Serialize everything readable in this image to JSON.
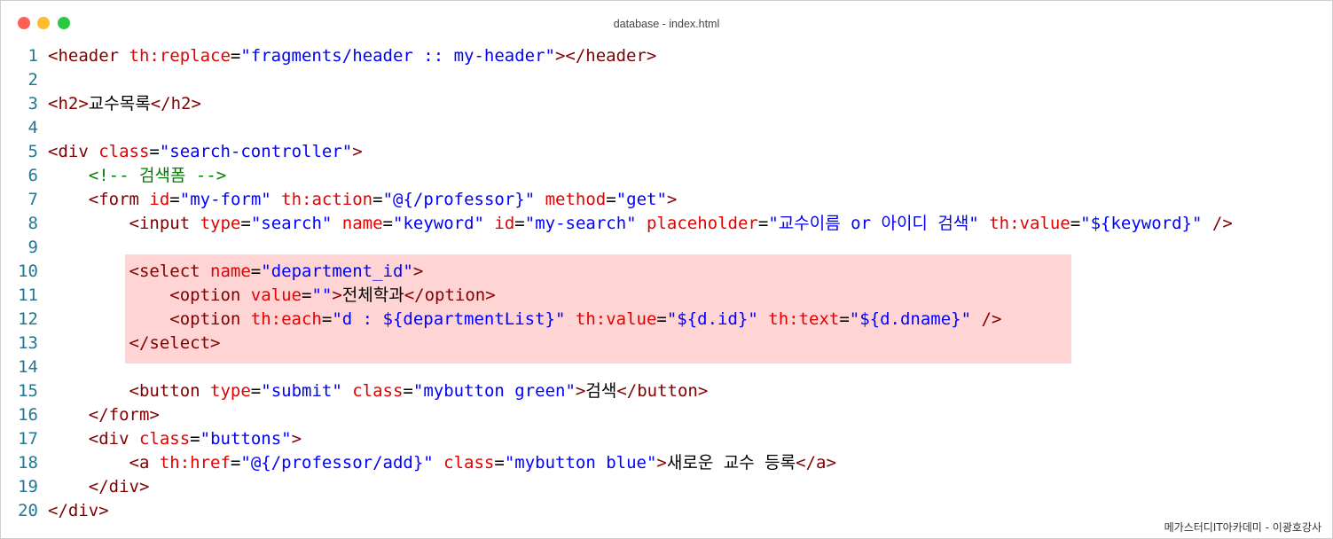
{
  "window": {
    "title": "database - index.html",
    "traffic_lights": {
      "close_color": "#ff5f57",
      "minimize_color": "#febc2e",
      "zoom_color": "#28c840"
    }
  },
  "colors": {
    "tag": "#800000",
    "attribute": "#e50000",
    "value": "#0000ff",
    "comment": "#008000",
    "text": "#000000",
    "line_number": "#237893",
    "highlight": "#ffd4d4"
  },
  "highlighted_lines": [
    10,
    11,
    12,
    13
  ],
  "lines": [
    {
      "num": "1",
      "tokens": [
        {
          "t": "tag",
          "v": "<header "
        },
        {
          "t": "attribute",
          "v": "th:replace"
        },
        {
          "t": "text",
          "v": "="
        },
        {
          "t": "value",
          "v": "\"fragments/header :: my-header\""
        },
        {
          "t": "tag",
          "v": "></header>"
        }
      ]
    },
    {
      "num": "2",
      "tokens": []
    },
    {
      "num": "3",
      "tokens": [
        {
          "t": "tag",
          "v": "<h2>"
        },
        {
          "t": "text",
          "v": "교수목록"
        },
        {
          "t": "tag",
          "v": "</h2>"
        }
      ]
    },
    {
      "num": "4",
      "tokens": []
    },
    {
      "num": "5",
      "tokens": [
        {
          "t": "tag",
          "v": "<div "
        },
        {
          "t": "attribute",
          "v": "class"
        },
        {
          "t": "text",
          "v": "="
        },
        {
          "t": "value",
          "v": "\"search-controller\""
        },
        {
          "t": "tag",
          "v": ">"
        }
      ]
    },
    {
      "num": "6",
      "tokens": [
        {
          "t": "text",
          "v": "    "
        },
        {
          "t": "comment",
          "v": "<!-- 검색폼 -->"
        }
      ]
    },
    {
      "num": "7",
      "tokens": [
        {
          "t": "text",
          "v": "    "
        },
        {
          "t": "tag",
          "v": "<form "
        },
        {
          "t": "attribute",
          "v": "id"
        },
        {
          "t": "text",
          "v": "="
        },
        {
          "t": "value",
          "v": "\"my-form\""
        },
        {
          "t": "text",
          "v": " "
        },
        {
          "t": "attribute",
          "v": "th:action"
        },
        {
          "t": "text",
          "v": "="
        },
        {
          "t": "value",
          "v": "\"@{/professor}\""
        },
        {
          "t": "text",
          "v": " "
        },
        {
          "t": "attribute",
          "v": "method"
        },
        {
          "t": "text",
          "v": "="
        },
        {
          "t": "value",
          "v": "\"get\""
        },
        {
          "t": "tag",
          "v": ">"
        }
      ]
    },
    {
      "num": "8",
      "tokens": [
        {
          "t": "text",
          "v": "        "
        },
        {
          "t": "tag",
          "v": "<input "
        },
        {
          "t": "attribute",
          "v": "type"
        },
        {
          "t": "text",
          "v": "="
        },
        {
          "t": "value",
          "v": "\"search\""
        },
        {
          "t": "text",
          "v": " "
        },
        {
          "t": "attribute",
          "v": "name"
        },
        {
          "t": "text",
          "v": "="
        },
        {
          "t": "value",
          "v": "\"keyword\""
        },
        {
          "t": "text",
          "v": " "
        },
        {
          "t": "attribute",
          "v": "id"
        },
        {
          "t": "text",
          "v": "="
        },
        {
          "t": "value",
          "v": "\"my-search\""
        },
        {
          "t": "text",
          "v": " "
        },
        {
          "t": "attribute",
          "v": "placeholder"
        },
        {
          "t": "text",
          "v": "="
        },
        {
          "t": "value",
          "v": "\"교수이름 or 아이디 검색\""
        },
        {
          "t": "text",
          "v": " "
        },
        {
          "t": "attribute",
          "v": "th:value"
        },
        {
          "t": "text",
          "v": "="
        },
        {
          "t": "value",
          "v": "\"${keyword}\""
        },
        {
          "t": "text",
          "v": " "
        },
        {
          "t": "tag",
          "v": "/>"
        }
      ]
    },
    {
      "num": "9",
      "tokens": []
    },
    {
      "num": "10",
      "tokens": [
        {
          "t": "text",
          "v": "        "
        },
        {
          "t": "tag",
          "v": "<select "
        },
        {
          "t": "attribute",
          "v": "name"
        },
        {
          "t": "text",
          "v": "="
        },
        {
          "t": "value",
          "v": "\"department_id\""
        },
        {
          "t": "tag",
          "v": ">"
        }
      ]
    },
    {
      "num": "11",
      "tokens": [
        {
          "t": "text",
          "v": "            "
        },
        {
          "t": "tag",
          "v": "<option "
        },
        {
          "t": "attribute",
          "v": "value"
        },
        {
          "t": "text",
          "v": "="
        },
        {
          "t": "value",
          "v": "\"\""
        },
        {
          "t": "tag",
          "v": ">"
        },
        {
          "t": "text",
          "v": "전체학과"
        },
        {
          "t": "tag",
          "v": "</option>"
        }
      ]
    },
    {
      "num": "12",
      "tokens": [
        {
          "t": "text",
          "v": "            "
        },
        {
          "t": "tag",
          "v": "<option "
        },
        {
          "t": "attribute",
          "v": "th:each"
        },
        {
          "t": "text",
          "v": "="
        },
        {
          "t": "value",
          "v": "\"d : ${departmentList}\""
        },
        {
          "t": "text",
          "v": " "
        },
        {
          "t": "attribute",
          "v": "th:value"
        },
        {
          "t": "text",
          "v": "="
        },
        {
          "t": "value",
          "v": "\"${d.id}\""
        },
        {
          "t": "text",
          "v": " "
        },
        {
          "t": "attribute",
          "v": "th:text"
        },
        {
          "t": "text",
          "v": "="
        },
        {
          "t": "value",
          "v": "\"${d.dname}\""
        },
        {
          "t": "text",
          "v": " "
        },
        {
          "t": "tag",
          "v": "/>"
        }
      ]
    },
    {
      "num": "13",
      "tokens": [
        {
          "t": "text",
          "v": "        "
        },
        {
          "t": "tag",
          "v": "</select>"
        }
      ]
    },
    {
      "num": "14",
      "tokens": []
    },
    {
      "num": "15",
      "tokens": [
        {
          "t": "text",
          "v": "        "
        },
        {
          "t": "tag",
          "v": "<button "
        },
        {
          "t": "attribute",
          "v": "type"
        },
        {
          "t": "text",
          "v": "="
        },
        {
          "t": "value",
          "v": "\"submit\""
        },
        {
          "t": "text",
          "v": " "
        },
        {
          "t": "attribute",
          "v": "class"
        },
        {
          "t": "text",
          "v": "="
        },
        {
          "t": "value",
          "v": "\"mybutton green\""
        },
        {
          "t": "tag",
          "v": ">"
        },
        {
          "t": "text",
          "v": "검색"
        },
        {
          "t": "tag",
          "v": "</button>"
        }
      ]
    },
    {
      "num": "16",
      "tokens": [
        {
          "t": "text",
          "v": "    "
        },
        {
          "t": "tag",
          "v": "</form>"
        }
      ]
    },
    {
      "num": "17",
      "tokens": [
        {
          "t": "text",
          "v": "    "
        },
        {
          "t": "tag",
          "v": "<div "
        },
        {
          "t": "attribute",
          "v": "class"
        },
        {
          "t": "text",
          "v": "="
        },
        {
          "t": "value",
          "v": "\"buttons\""
        },
        {
          "t": "tag",
          "v": ">"
        }
      ]
    },
    {
      "num": "18",
      "tokens": [
        {
          "t": "text",
          "v": "        "
        },
        {
          "t": "tag",
          "v": "<a "
        },
        {
          "t": "attribute",
          "v": "th:href"
        },
        {
          "t": "text",
          "v": "="
        },
        {
          "t": "value",
          "v": "\"@{/professor/add}\""
        },
        {
          "t": "text",
          "v": " "
        },
        {
          "t": "attribute",
          "v": "class"
        },
        {
          "t": "text",
          "v": "="
        },
        {
          "t": "value",
          "v": "\"mybutton blue\""
        },
        {
          "t": "tag",
          "v": ">"
        },
        {
          "t": "text",
          "v": "새로운 교수 등록"
        },
        {
          "t": "tag",
          "v": "</a>"
        }
      ]
    },
    {
      "num": "19",
      "tokens": [
        {
          "t": "text",
          "v": "    "
        },
        {
          "t": "tag",
          "v": "</div>"
        }
      ]
    },
    {
      "num": "20",
      "tokens": [
        {
          "t": "tag",
          "v": "</div>"
        }
      ]
    }
  ],
  "watermark": "메가스터디IT아카데미 - 이광호강사"
}
